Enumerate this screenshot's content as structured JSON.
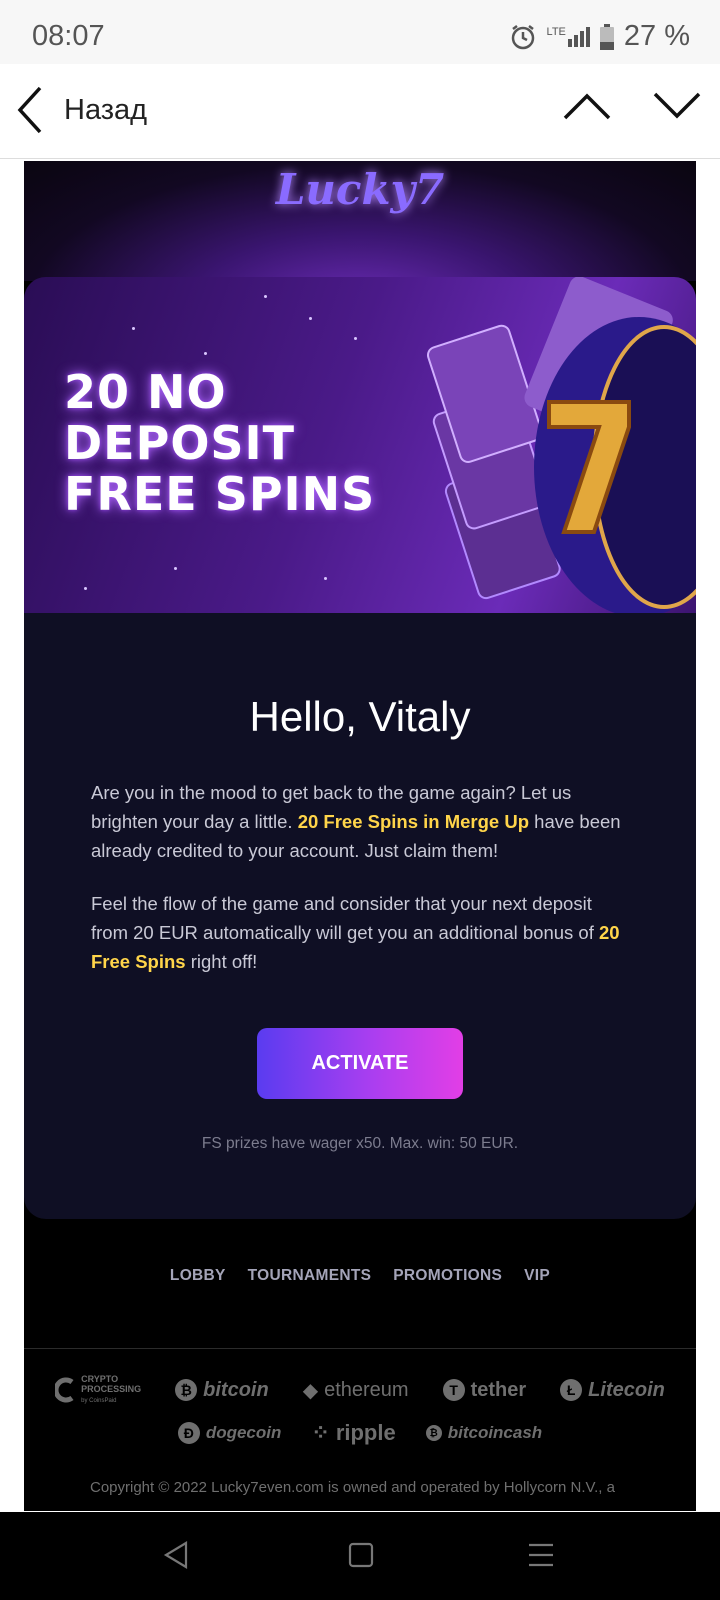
{
  "status_bar": {
    "time": "08:07",
    "battery": "27 %",
    "network": "LTE"
  },
  "nav": {
    "back_label": "Назад"
  },
  "email": {
    "logo": "Lucky7",
    "banner_headline": [
      "20 NO",
      "DEPOSIT",
      "FREE SPINS"
    ],
    "greeting": "Hello, Vitaly",
    "para1": {
      "before": "Are you in the mood to get back to the game again? Let us brighten your day a little. ",
      "highlight": "20 Free Spins in Merge Up",
      "after": " have been already credited to your account. Just claim them!"
    },
    "para2": {
      "before": "Feel the flow of the game and consider that your next deposit from 20 EUR automatically will get you an additional bonus of ",
      "highlight": "20 Free Spins",
      "after": " right off!"
    },
    "activate_label": "ACTIVATE",
    "wager_note": "FS prizes have wager x50. Max. win: 50 EUR.",
    "footer_links": [
      "LOBBY",
      "TOURNAMENTS",
      "PROMOTIONS",
      "VIP"
    ],
    "payments_row1": [
      "bitcoin",
      "ethereum",
      "tether",
      "Litecoin"
    ],
    "payments_row2": [
      "dogecoin",
      "ripple",
      "bitcoincash"
    ],
    "crypto_processing": [
      "CRYPTO",
      "PROCESSING",
      "by CoinsPaid"
    ],
    "copyright": "Copyright © 2022 Lucky7even.com is owned and operated by Hollycorn N.V., a"
  },
  "colors": {
    "accent_highlight": "#ffd54a",
    "card_bg": "#0f0f24",
    "button_start": "#5a3cf0",
    "button_end": "#e23ee6"
  }
}
